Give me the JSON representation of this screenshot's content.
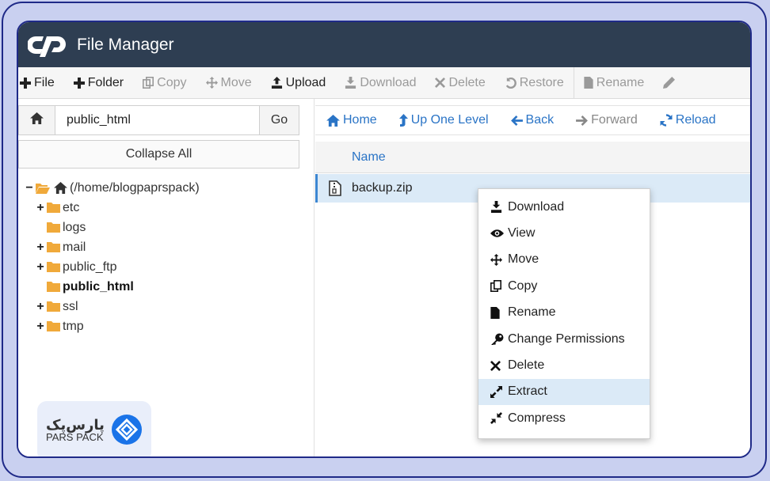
{
  "app": {
    "title": "File Manager",
    "logo_icon": "cpanel-logo-icon"
  },
  "toolbar": {
    "items": [
      {
        "label": "File",
        "icon": "plus-icon",
        "enabled": true
      },
      {
        "label": "Folder",
        "icon": "plus-icon",
        "enabled": true
      },
      {
        "label": "Copy",
        "icon": "copy-icon",
        "enabled": false
      },
      {
        "label": "Move",
        "icon": "move-icon",
        "enabled": false
      },
      {
        "label": "Upload",
        "icon": "upload-icon",
        "enabled": true
      },
      {
        "label": "Download",
        "icon": "download-icon",
        "enabled": false
      },
      {
        "label": "Delete",
        "icon": "times-icon",
        "enabled": false
      },
      {
        "label": "Restore",
        "icon": "undo-icon",
        "enabled": false
      },
      {
        "label": "Rename",
        "icon": "file-icon",
        "enabled": false
      }
    ]
  },
  "path_bar": {
    "value": "public_html",
    "go_label": "Go"
  },
  "tree": {
    "collapse_label": "Collapse All",
    "root": "(/home/blogpaprspack)",
    "items": [
      {
        "label": "etc",
        "expandable": true,
        "bold": false
      },
      {
        "label": "logs",
        "expandable": false,
        "bold": false
      },
      {
        "label": "mail",
        "expandable": true,
        "bold": false
      },
      {
        "label": "public_ftp",
        "expandable": true,
        "bold": false
      },
      {
        "label": "public_html",
        "expandable": false,
        "bold": true
      },
      {
        "label": "ssl",
        "expandable": true,
        "bold": false
      },
      {
        "label": "tmp",
        "expandable": true,
        "bold": false
      }
    ]
  },
  "nav": {
    "home": "Home",
    "up": "Up One Level",
    "back": "Back",
    "forward": "Forward",
    "reload": "Reload"
  },
  "table": {
    "column_name": "Name",
    "rows": [
      {
        "name": "backup.zip",
        "icon": "zip-file-icon"
      }
    ]
  },
  "context_menu": {
    "items": [
      {
        "label": "Download",
        "icon": "download-icon"
      },
      {
        "label": "View",
        "icon": "eye-icon"
      },
      {
        "label": "Move",
        "icon": "move-icon"
      },
      {
        "label": "Copy",
        "icon": "copy-icon"
      },
      {
        "label": "Rename",
        "icon": "file-icon"
      },
      {
        "label": "Change Permissions",
        "icon": "key-icon"
      },
      {
        "label": "Delete",
        "icon": "times-icon"
      },
      {
        "label": "Extract",
        "icon": "expand-icon",
        "highlighted": true
      },
      {
        "label": "Compress",
        "icon": "compress-icon"
      }
    ]
  },
  "branding": {
    "name_fa": "پارس‌پک",
    "name_en": "PARS PACK",
    "icon": "parspack-logo-icon",
    "accent": "#1a73e8"
  },
  "colors": {
    "titlebar": "#2e3e52",
    "link": "#2a74c6",
    "folder": "#f0a93a",
    "selection": "#dbeaf7",
    "frame": "#1f2a88"
  }
}
